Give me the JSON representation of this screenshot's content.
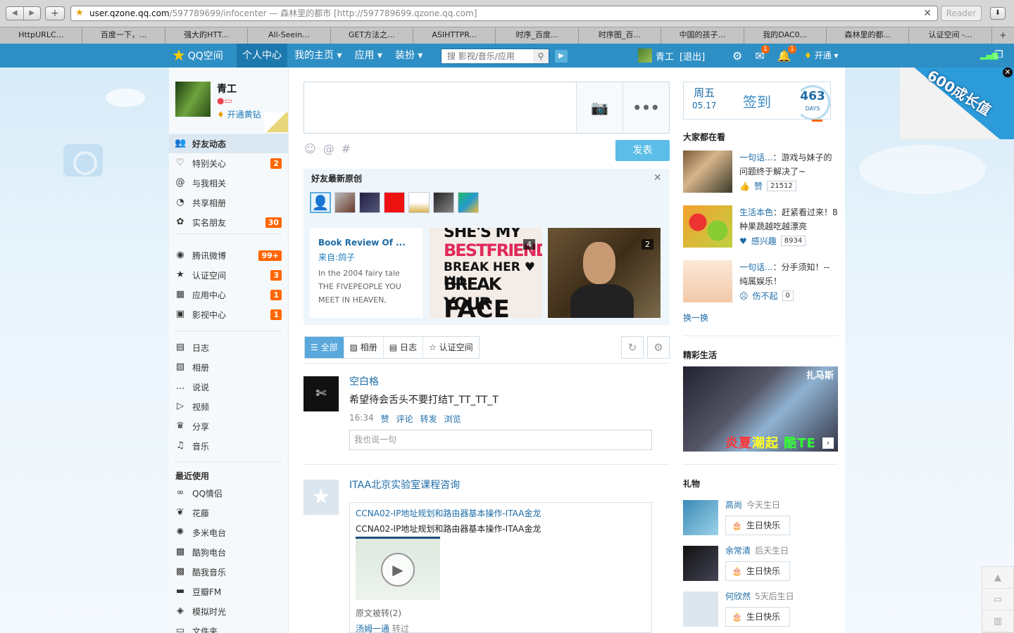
{
  "browser": {
    "url_host": "user.qzone.qq.com",
    "url_path": "/597789699/infocenter",
    "url_desc": " — 森林里的都市 [http://597789699.qzone.qq.com]",
    "reader_label": "Reader",
    "tabs": [
      "HttpURLC...",
      "百度一下，...",
      "强大的HTT...",
      "All-Seein...",
      "GET方法之...",
      "ASIHTTPR...",
      "时序_百度...",
      "时序图_百...",
      "中国的孩子...",
      "我的DAC0...",
      "森林里的都...",
      "认证空间 -..."
    ]
  },
  "topbar": {
    "logo": "QQ空间",
    "nav": [
      "个人中心",
      "我的主页 ▾",
      "应用 ▾",
      "装扮 ▾"
    ],
    "search_placeholder": "搜 影视/音乐/应用",
    "user_name": "青工",
    "logout": "[退出]",
    "mail_badge": "1",
    "notify_badge": "1",
    "kaitong": "开通 ▾"
  },
  "profile": {
    "name": "青工",
    "vip": "开通黄钻"
  },
  "menu1": [
    {
      "label": "好友动态",
      "icon": "friends-icon",
      "glyph": "👥",
      "count": ""
    },
    {
      "label": "特别关心",
      "icon": "heart-icon",
      "glyph": "♡",
      "count": "2"
    },
    {
      "label": "与我相关",
      "icon": "at-icon",
      "glyph": "@",
      "count": ""
    },
    {
      "label": "共享相册",
      "icon": "shared-album-icon",
      "glyph": "◔",
      "count": ""
    },
    {
      "label": "实名朋友",
      "icon": "realname-icon",
      "glyph": "✿",
      "count": "30"
    }
  ],
  "menu2": [
    {
      "label": "腾讯微博",
      "icon": "weibo-icon",
      "glyph": "◉",
      "count": "99+"
    },
    {
      "label": "认证空间",
      "icon": "certified-icon",
      "glyph": "★",
      "count": "3"
    },
    {
      "label": "应用中心",
      "icon": "app-center-icon",
      "glyph": "▦",
      "count": "1"
    },
    {
      "label": "影视中心",
      "icon": "video-center-icon",
      "glyph": "▣",
      "count": "1"
    }
  ],
  "menu3": [
    {
      "label": "日志",
      "icon": "blog-icon",
      "glyph": "▤"
    },
    {
      "label": "相册",
      "icon": "album-icon",
      "glyph": "▨"
    },
    {
      "label": "说说",
      "icon": "talk-icon",
      "glyph": "…"
    },
    {
      "label": "视频",
      "icon": "video-icon",
      "glyph": "▷"
    },
    {
      "label": "分享",
      "icon": "share-icon",
      "glyph": "♛"
    },
    {
      "label": "音乐",
      "icon": "music-icon",
      "glyph": "♫"
    }
  ],
  "recent_title": "最近使用",
  "menu4": [
    {
      "label": "QQ情侣",
      "icon": "couple-icon",
      "glyph": "∞"
    },
    {
      "label": "花藤",
      "icon": "flower-vine-icon",
      "glyph": "❦"
    },
    {
      "label": "多米电台",
      "icon": "duomi-icon",
      "glyph": "✺"
    },
    {
      "label": "酷狗电台",
      "icon": "kugou-icon",
      "glyph": "▩"
    },
    {
      "label": "酷我音乐",
      "icon": "kuwo-icon",
      "glyph": "▩"
    },
    {
      "label": "豆瓣FM",
      "icon": "douban-icon",
      "glyph": "▬"
    },
    {
      "label": "模拟时光",
      "icon": "sim-time-icon",
      "glyph": "◈"
    },
    {
      "label": "文件夹",
      "icon": "folder-icon",
      "glyph": "▭"
    }
  ],
  "composer": {
    "post_label": "发表"
  },
  "originals": {
    "title": "好友最新原创",
    "book_title": "Book Review Of ...",
    "book_source": "来自:鸽子",
    "book_excerpt": "In the 2004 fairy tale THE FIVEPEOPLE YOU MEET IN HEAVEN,",
    "img1_lines": [
      "SHE'S MY",
      "BESTFRIEND",
      "BREAK HER ♥ I'LL",
      "BREAK YOUR",
      "FACE"
    ],
    "img1_count": "4",
    "img2_count": "2"
  },
  "filters": [
    "全部",
    "相册",
    "日志",
    "认证空间"
  ],
  "feed1": {
    "name": "空白格",
    "text": "希望待会舌头不要打结T_TT_TT_T",
    "time": "16:34",
    "actions": [
      "赞",
      "评论",
      "转发",
      "浏览"
    ],
    "comment_placeholder": "我也说一句"
  },
  "feed2": {
    "name": "ITAA北京实验室课程咨询",
    "share_link": "CCNA02-IP地址规划和路由器基本操作-ITAA金龙",
    "share_title": "CCNA02-IP地址规划和路由器基本操作-ITAA金龙",
    "reposted": "原文被转(2)",
    "repost_user": "汤姆一通",
    "repost_action": "转过"
  },
  "signin": {
    "weekday": "周五",
    "date": "05.17",
    "label": "签到",
    "days": "463",
    "days_unit": "DAYS"
  },
  "everyone_title": "大家都在看",
  "everyone": [
    {
      "user": "一句话...",
      "text": "：游戏与妹子的问题终于解决了~",
      "action": "赞",
      "count": "21512",
      "icon": "like-icon",
      "glyph": "👍"
    },
    {
      "user": "生活本色",
      "text": "：赶紧看过来！8种果蔬越吃越漂亮",
      "action": "感兴趣",
      "count": "8934",
      "icon": "heart-icon",
      "glyph": "♥"
    },
    {
      "user": "一句话...",
      "text": "：分手须知！--纯属娱乐！",
      "action": "伤不起",
      "count": "0",
      "icon": "sad-icon",
      "glyph": "☹"
    }
  ],
  "huan": "换一换",
  "life_title": "精彩生活",
  "life_tag": "扎马斯",
  "life_banner": [
    "炎夏",
    "潮起",
    "酷TE"
  ],
  "gift_title": "礼物",
  "gifts": [
    {
      "name": "高尚",
      "when": "今天生日",
      "btn": "生日快乐"
    },
    {
      "name": "余常清",
      "when": "后天生日",
      "btn": "生日快乐"
    },
    {
      "name": "何欣然",
      "when": "5天后生日",
      "btn": "生日快乐"
    }
  ],
  "ad_text": "600成长值",
  "colors": {
    "accent": "#2e8fc5",
    "count_badge": "#ff6600",
    "link": "#1d6ca7"
  }
}
